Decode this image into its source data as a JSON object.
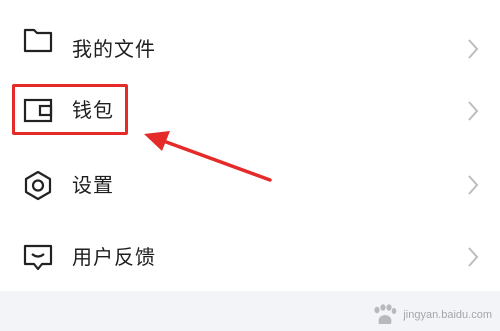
{
  "menu": {
    "items": [
      {
        "label": "我的文件",
        "icon": "folder-icon"
      },
      {
        "label": "钱包",
        "icon": "wallet-icon"
      },
      {
        "label": "设置",
        "icon": "settings-hexagon-icon"
      },
      {
        "label": "用户反馈",
        "icon": "feedback-message-icon"
      }
    ]
  },
  "annotation": {
    "highlight_color": "#e52a2a",
    "arrow_color": "#e52a2a"
  },
  "watermark": {
    "url": "jingyan.baidu.com"
  },
  "colors": {
    "text": "#1e1e1e",
    "icon": "#222222",
    "chevron": "#bdbdbd",
    "footer_bg": "#f3f4f8"
  }
}
